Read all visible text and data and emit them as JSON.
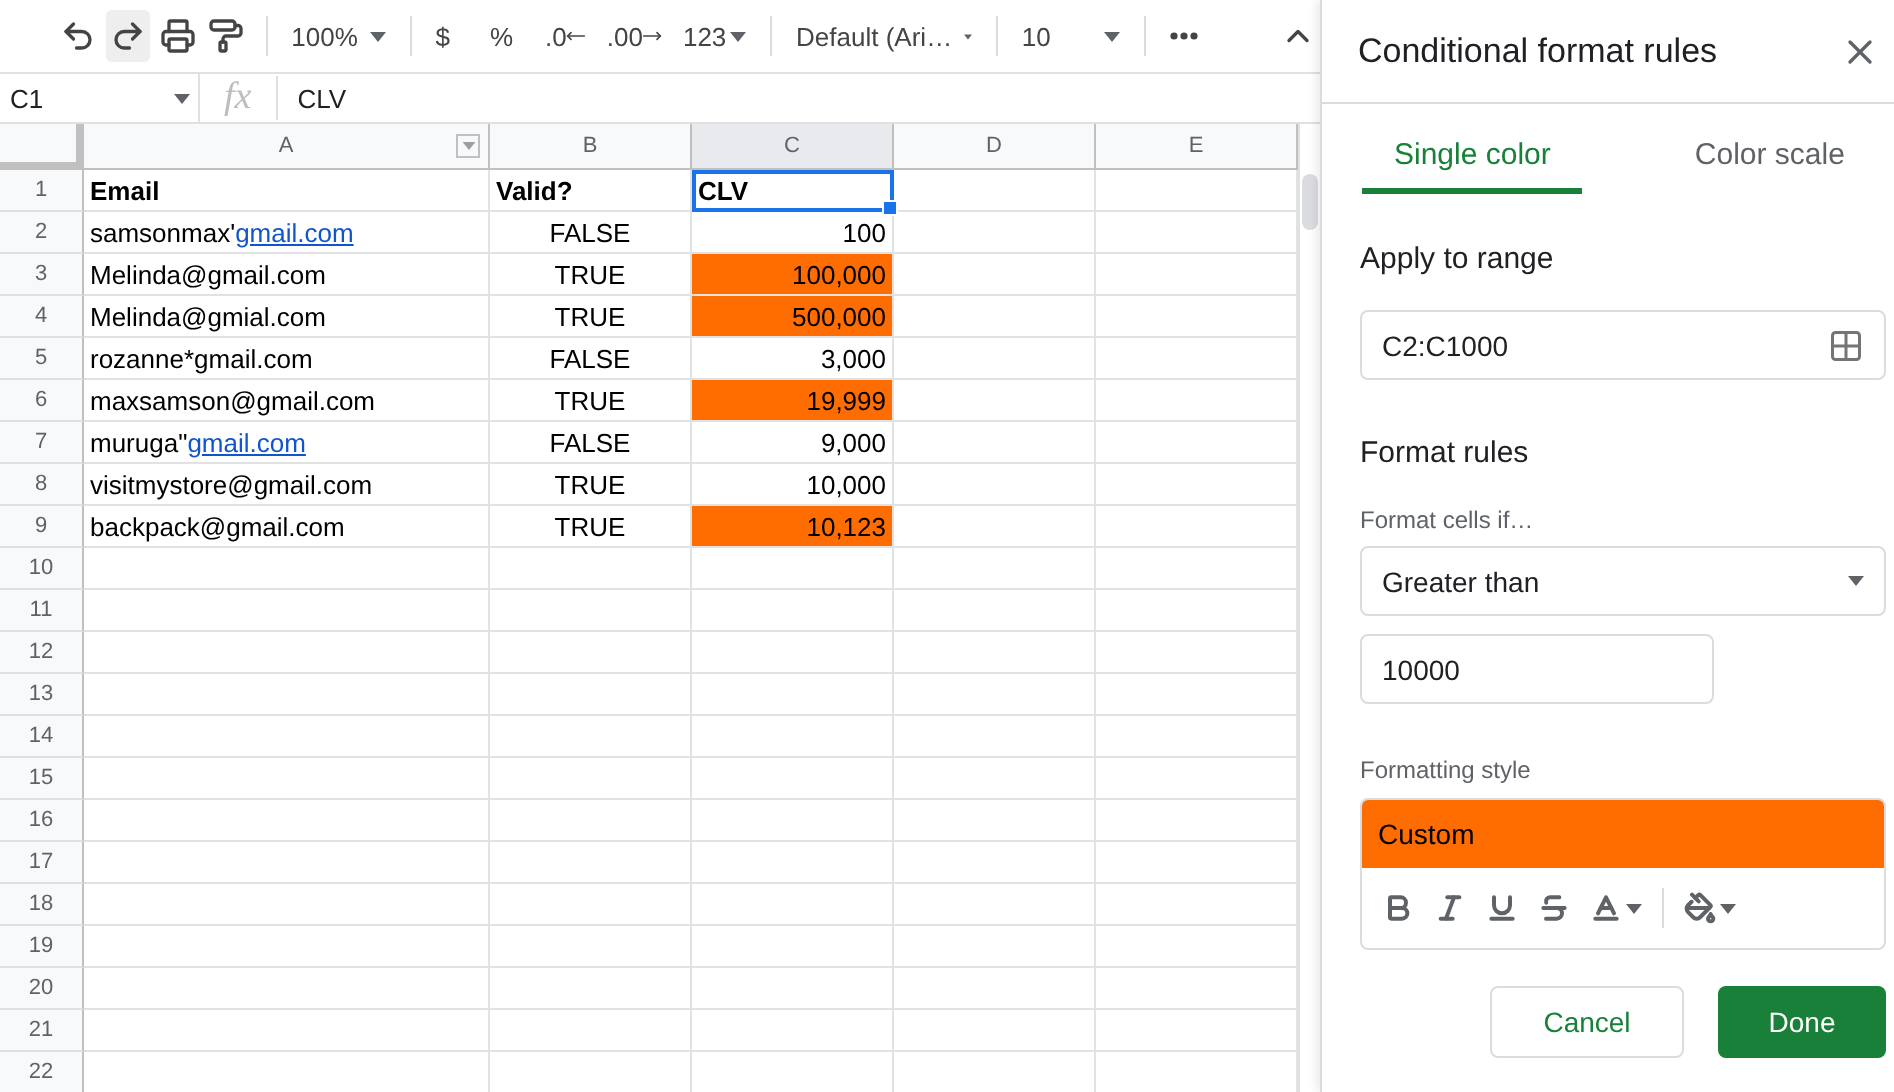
{
  "toolbar": {
    "zoom": "100%",
    "currency": "$",
    "percent": "%",
    "decrease_decimal": ".0",
    "increase_decimal": ".00",
    "number_format": "123",
    "font": "Default (Ari…",
    "font_size": "10"
  },
  "formula_bar": {
    "cell_ref": "C1",
    "function_label": "fx",
    "value": "CLV"
  },
  "sheet": {
    "columns": [
      {
        "label": "A",
        "selected": false,
        "filter": true
      },
      {
        "label": "B",
        "selected": false,
        "filter": false
      },
      {
        "label": "C",
        "selected": true,
        "filter": false
      },
      {
        "label": "D",
        "selected": false,
        "filter": false
      },
      {
        "label": "E",
        "selected": false,
        "filter": false
      }
    ],
    "rows": [
      {
        "number": "1",
        "cells": [
          {
            "kind": "header",
            "text": "Email",
            "selected": false,
            "highlighted": false
          },
          {
            "kind": "header",
            "text": "Valid?",
            "selected": false,
            "highlighted": false
          },
          {
            "kind": "header",
            "text": "CLV",
            "selected": true,
            "highlighted": false
          }
        ]
      },
      {
        "number": "2",
        "cells": [
          {
            "kind": "text",
            "text": "samsonmax'",
            "link": "gmail.com",
            "selected": false,
            "highlighted": false
          },
          {
            "kind": "boolean",
            "text": "FALSE",
            "selected": false,
            "highlighted": false
          },
          {
            "kind": "number",
            "text": "100",
            "selected": false,
            "highlighted": false
          }
        ]
      },
      {
        "number": "3",
        "cells": [
          {
            "kind": "text",
            "text": "Melinda@gmail.com",
            "selected": false,
            "highlighted": false
          },
          {
            "kind": "boolean",
            "text": "TRUE",
            "selected": false,
            "highlighted": false
          },
          {
            "kind": "number",
            "text": "100,000",
            "selected": false,
            "highlighted": true
          }
        ]
      },
      {
        "number": "4",
        "cells": [
          {
            "kind": "text",
            "text": "Melinda@gmial.com",
            "selected": false,
            "highlighted": false
          },
          {
            "kind": "boolean",
            "text": "TRUE",
            "selected": false,
            "highlighted": false
          },
          {
            "kind": "number",
            "text": "500,000",
            "selected": false,
            "highlighted": true
          }
        ]
      },
      {
        "number": "5",
        "cells": [
          {
            "kind": "text",
            "text": "rozanne*gmail.com",
            "selected": false,
            "highlighted": false
          },
          {
            "kind": "boolean",
            "text": "FALSE",
            "selected": false,
            "highlighted": false
          },
          {
            "kind": "number",
            "text": "3,000",
            "selected": false,
            "highlighted": false
          }
        ]
      },
      {
        "number": "6",
        "cells": [
          {
            "kind": "text",
            "text": "maxsamson@gmail.com",
            "selected": false,
            "highlighted": false
          },
          {
            "kind": "boolean",
            "text": "TRUE",
            "selected": false,
            "highlighted": false
          },
          {
            "kind": "number",
            "text": "19,999",
            "selected": false,
            "highlighted": true
          }
        ]
      },
      {
        "number": "7",
        "cells": [
          {
            "kind": "text",
            "text": "muruga\"",
            "link": "gmail.com",
            "selected": false,
            "highlighted": false
          },
          {
            "kind": "boolean",
            "text": "FALSE",
            "selected": false,
            "highlighted": false
          },
          {
            "kind": "number",
            "text": "9,000",
            "selected": false,
            "highlighted": false
          }
        ]
      },
      {
        "number": "8",
        "cells": [
          {
            "kind": "text",
            "text": "visitmystore@gmail.com",
            "selected": false,
            "highlighted": false
          },
          {
            "kind": "boolean",
            "text": "TRUE",
            "selected": false,
            "highlighted": false
          },
          {
            "kind": "number",
            "text": "10,000",
            "selected": false,
            "highlighted": false
          }
        ]
      },
      {
        "number": "9",
        "cells": [
          {
            "kind": "text",
            "text": "backpack@gmail.com",
            "selected": false,
            "highlighted": false
          },
          {
            "kind": "boolean",
            "text": "TRUE",
            "selected": false,
            "highlighted": false
          },
          {
            "kind": "number",
            "text": "10,123",
            "selected": false,
            "highlighted": true
          }
        ]
      },
      {
        "number": "10"
      },
      {
        "number": "11"
      },
      {
        "number": "12"
      },
      {
        "number": "13"
      },
      {
        "number": "14"
      },
      {
        "number": "15"
      },
      {
        "number": "16"
      },
      {
        "number": "17"
      },
      {
        "number": "18"
      },
      {
        "number": "19"
      },
      {
        "number": "20"
      },
      {
        "number": "21"
      },
      {
        "number": "22"
      }
    ]
  },
  "panel": {
    "title": "Conditional format rules",
    "tabs": [
      {
        "label": "Single color",
        "selected": true
      },
      {
        "label": "Color scale",
        "selected": false
      }
    ],
    "apply_to_range": {
      "label": "Apply to range",
      "value": "C2:C1000"
    },
    "format_rules": {
      "heading": "Format rules",
      "condition_label": "Format cells if…",
      "condition": "Greater than",
      "value": "10000"
    },
    "formatting_style": {
      "label": "Formatting style",
      "preview": "Custom"
    },
    "buttons": {
      "cancel": "Cancel",
      "done": "Done"
    }
  }
}
